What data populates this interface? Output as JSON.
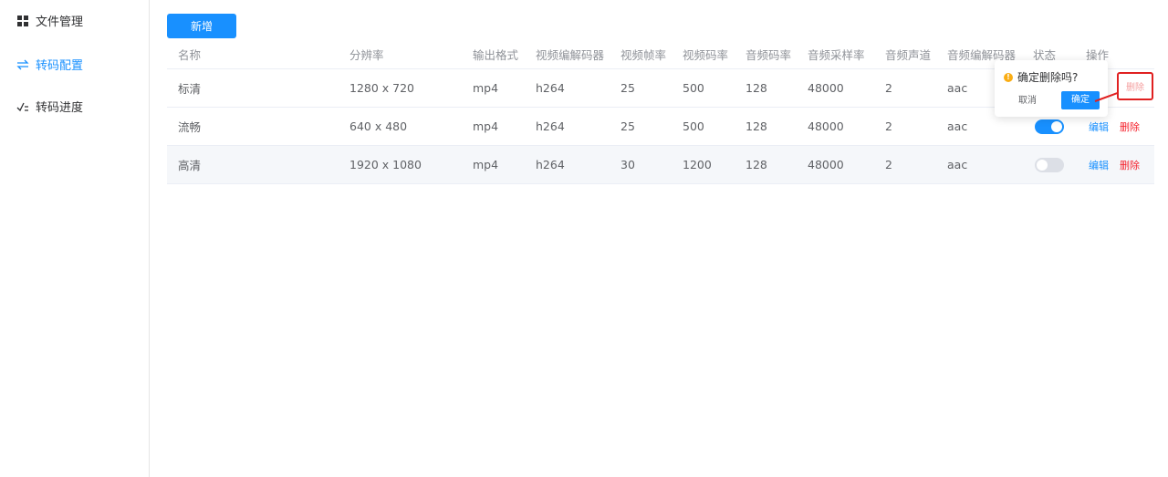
{
  "sidebar": {
    "items": [
      {
        "label": "文件管理",
        "icon": "grid-icon",
        "active": false
      },
      {
        "label": "转码配置",
        "icon": "exchange-icon",
        "active": true
      },
      {
        "label": "转码进度",
        "icon": "progress-icon",
        "active": false
      }
    ]
  },
  "toolbar": {
    "add_label": "新增"
  },
  "table": {
    "headers": [
      "名称",
      "分辨率",
      "输出格式",
      "视频编解码器",
      "视频帧率",
      "视频码率",
      "音频码率",
      "音频采样率",
      "音频声道",
      "音频编解码器",
      "状态",
      "操作"
    ],
    "rows": [
      {
        "name": "标清",
        "resolution": "1280 x 720",
        "format": "mp4",
        "vcodec": "h264",
        "fps": "25",
        "vbitrate": "500",
        "abitrate": "128",
        "samplerate": "48000",
        "channels": "2",
        "acodec": "aac",
        "enabled": true
      },
      {
        "name": "流畅",
        "resolution": "640 x 480",
        "format": "mp4",
        "vcodec": "h264",
        "fps": "25",
        "vbitrate": "500",
        "abitrate": "128",
        "samplerate": "48000",
        "channels": "2",
        "acodec": "aac",
        "enabled": true
      },
      {
        "name": "高清",
        "resolution": "1920 x 1080",
        "format": "mp4",
        "vcodec": "h264",
        "fps": "30",
        "vbitrate": "1200",
        "abitrate": "128",
        "samplerate": "48000",
        "channels": "2",
        "acodec": "aac",
        "enabled": false
      }
    ],
    "actions": {
      "edit_label": "编辑",
      "delete_label": "删除"
    }
  },
  "popconfirm": {
    "message": "确定删除吗?",
    "cancel_label": "取消",
    "confirm_label": "确定"
  },
  "highlight": {
    "label": "删除"
  },
  "colors": {
    "primary": "#1890ff",
    "danger": "#f5222d",
    "warning": "#faad14",
    "annotation": "#e02020"
  }
}
